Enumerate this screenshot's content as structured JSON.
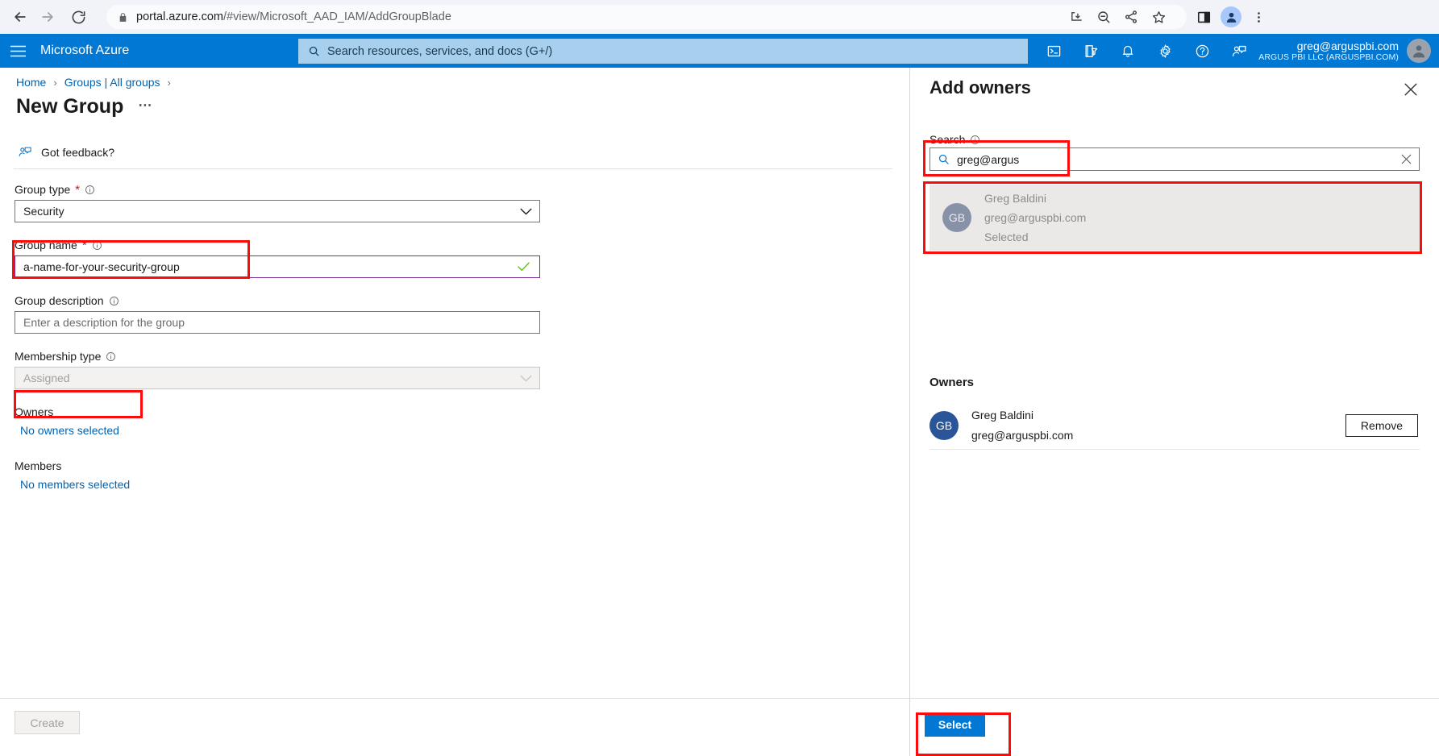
{
  "browser": {
    "back_icon": "back-arrow-icon",
    "forward_icon": "forward-arrow-icon",
    "reload_icon": "reload-icon",
    "lock_icon": "lock-icon",
    "url_domain": "portal.azure.com",
    "url_path": "/#view/Microsoft_AAD_IAM/AddGroupBlade",
    "toolbar_icons": [
      "install-icon",
      "zoom-out-icon",
      "share-icon",
      "bookmark-star-icon",
      "side-panel-icon",
      "profile-avatar-icon",
      "chrome-menu-icon"
    ]
  },
  "azure_header": {
    "menu_icon": "hamburger-menu-icon",
    "brand": "Microsoft Azure",
    "search_icon": "search-icon",
    "search_placeholder": "Search resources, services, and docs (G+/)",
    "icons": [
      "cloud-shell-icon",
      "directories-filter-icon",
      "notifications-bell-icon",
      "settings-gear-icon",
      "help-question-icon",
      "feedback-icon"
    ],
    "account_email": "greg@arguspbi.com",
    "account_org": "ARGUS PBI LLC (ARGUSPBI.COM)",
    "account_avatar": "user-avatar-icon"
  },
  "breadcrumb": {
    "items": [
      "Home",
      "Groups | All groups"
    ],
    "separator": "›"
  },
  "page": {
    "title": "New Group",
    "ellipsis": "⋯",
    "feedback_icon": "feedback-person-icon",
    "feedback_label": "Got feedback?"
  },
  "form": {
    "group_type": {
      "label": "Group type",
      "required_star": "*",
      "info_icon": "info-circle-icon",
      "value": "Security",
      "chevron_icon": "chevron-down-icon"
    },
    "group_name": {
      "label": "Group name",
      "required_star": "*",
      "info_icon": "info-circle-icon",
      "value": "a-name-for-your-security-group",
      "check_icon": "green-check-icon",
      "border_color": "#7a2f99"
    },
    "group_description": {
      "label": "Group description",
      "info_icon": "info-circle-icon",
      "placeholder": "Enter a description for the group",
      "value": ""
    },
    "membership_type": {
      "label": "Membership type",
      "info_icon": "info-circle-icon",
      "value": "Assigned",
      "chevron_icon": "chevron-down-icon",
      "disabled": true
    },
    "owners": {
      "label": "Owners",
      "link_text": "No owners selected"
    },
    "members": {
      "label": "Members",
      "link_text": "No members selected"
    }
  },
  "footer": {
    "create_label": "Create"
  },
  "panel": {
    "title": "Add owners",
    "close_icon": "close-x-icon",
    "search": {
      "label": "Search",
      "info_icon": "info-circle-icon",
      "search_icon": "search-icon",
      "value": "greg@argus",
      "clear_icon": "clear-x-icon"
    },
    "result": {
      "initials": "GB",
      "name": "Greg Baldini",
      "email": "greg@arguspbi.com",
      "status": "Selected"
    },
    "owners_section": {
      "heading": "Owners",
      "rows": [
        {
          "initials": "GB",
          "name": "Greg Baldini",
          "email": "greg@arguspbi.com",
          "remove_label": "Remove"
        }
      ]
    },
    "select_label": "Select"
  },
  "annotations": {
    "color": "#fc0b0b",
    "boxes": [
      "group-name-input",
      "no-owners-selected-link",
      "panel-search-input",
      "panel-search-result",
      "select-button"
    ]
  }
}
